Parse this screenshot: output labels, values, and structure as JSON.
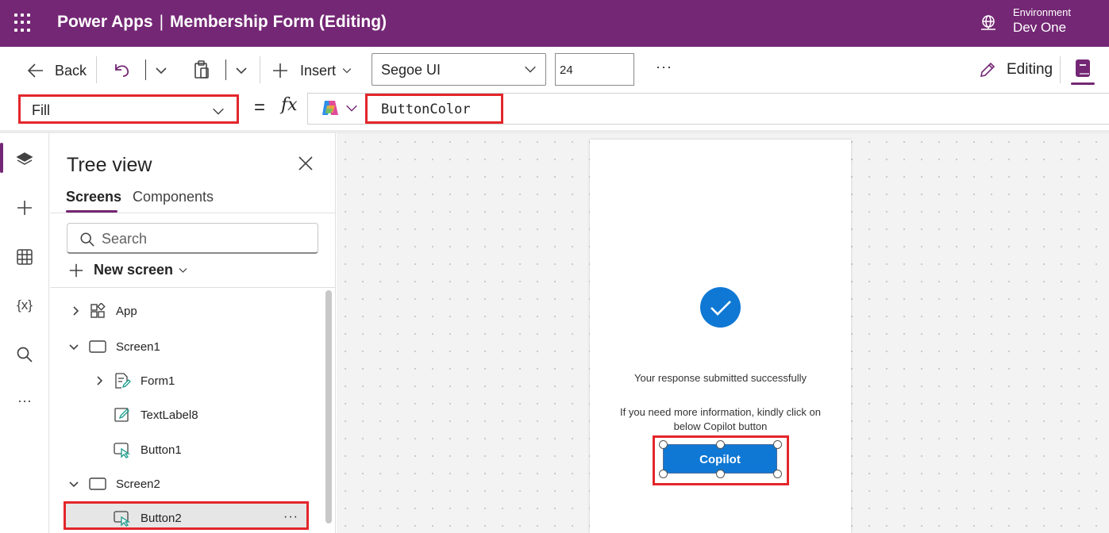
{
  "header": {
    "app_name": "Power Apps",
    "separator": "|",
    "document_title": "Membership Form (Editing)",
    "environment_label": "Environment",
    "environment_name": "Dev One",
    "background_color": "#742774"
  },
  "command_bar": {
    "back_label": "Back",
    "insert_label": "Insert",
    "font_family_value": "Segoe UI",
    "font_size_value": "24",
    "more_label": "···",
    "mode_label": "Editing"
  },
  "formula_bar": {
    "property_value": "Fill",
    "equals": "=",
    "fx": "fx",
    "formula_value": "ButtonColor"
  },
  "left_rail": {
    "icons": [
      "layers-icon",
      "add-icon",
      "table-icon",
      "variables-icon",
      "search-icon",
      "more-icon"
    ],
    "variables_glyph": "{x}",
    "more_glyph": "···"
  },
  "tree_view": {
    "title": "Tree view",
    "tabs": [
      "Screens",
      "Components"
    ],
    "search_placeholder": "Search",
    "new_screen_label": "New screen",
    "nodes": [
      {
        "label": "App"
      },
      {
        "label": "Screen1"
      },
      {
        "label": "Form1"
      },
      {
        "label": "TextLabel8"
      },
      {
        "label": "Button1"
      },
      {
        "label": "Screen2"
      },
      {
        "label": "Button2"
      }
    ],
    "row_more": "···"
  },
  "canvas": {
    "success_message": "Your response submitted successfully",
    "info_message": "If you need more information, kindly click on below Copilot button",
    "button_label": "Copilot",
    "button_color": "#0F78D4",
    "highlight_color": "#E3262B"
  }
}
